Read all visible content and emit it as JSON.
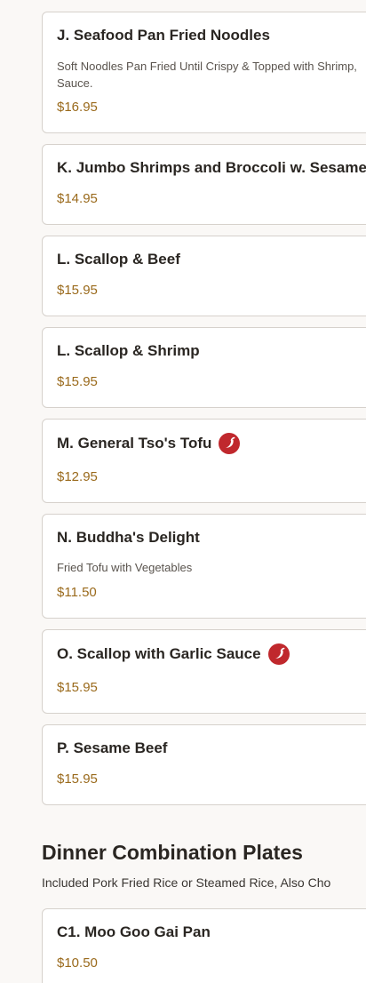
{
  "items": [
    {
      "name": "J. Seafood Pan Fried Noodles",
      "desc": "Soft Noodles Pan Fried Until Crispy & Topped with Shrimp, Sauce.",
      "price": "$16.95",
      "spicy": false
    },
    {
      "name": "K. Jumbo Shrimps and Broccoli w. Sesame",
      "desc": "",
      "price": "$14.95",
      "spicy": false
    },
    {
      "name": "L. Scallop & Beef",
      "desc": "",
      "price": "$15.95",
      "spicy": false
    },
    {
      "name": "L. Scallop & Shrimp",
      "desc": "",
      "price": "$15.95",
      "spicy": false
    },
    {
      "name": "M. General Tso's Tofu",
      "desc": "",
      "price": "$12.95",
      "spicy": true
    },
    {
      "name": "N. Buddha's Delight",
      "desc": "Fried Tofu with Vegetables",
      "price": "$11.50",
      "spicy": false
    },
    {
      "name": "O. Scallop with Garlic Sauce",
      "desc": "",
      "price": "$15.95",
      "spicy": true
    },
    {
      "name": "P. Sesame Beef",
      "desc": "",
      "price": "$15.95",
      "spicy": false
    }
  ],
  "section": {
    "title": "Dinner Combination Plates",
    "subtitle": "Included Pork Fried Rice or Steamed Rice, Also Cho"
  },
  "section_items": [
    {
      "name": "C1. Moo Goo Gai Pan",
      "desc": "",
      "price": "$10.50",
      "spicy": false
    }
  ],
  "colors": {
    "price": "#9a6a1c",
    "spicy_icon": "#c0282d",
    "card_border": "#d6d1cc",
    "background": "#faf8f6"
  },
  "icons": {
    "spicy": "chili-pepper-icon"
  }
}
